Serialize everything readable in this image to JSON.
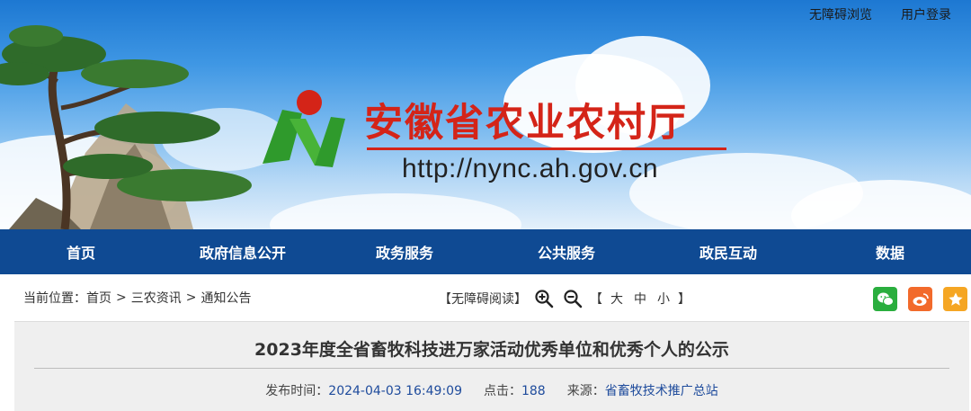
{
  "top_links": {
    "accessible": "无障碍浏览",
    "login": "用户登录"
  },
  "banner": {
    "site_title": "安徽省农业农村厅",
    "site_url": "http://nync.ah.gov.cn",
    "colors": {
      "title": "#d42418",
      "logo_green": "#2f9a2c",
      "logo_red": "#d42418"
    }
  },
  "nav": {
    "items": [
      "首页",
      "政府信息公开",
      "政务服务",
      "公共服务",
      "政民互动",
      "数据"
    ],
    "background": "#0f4a93"
  },
  "breadcrumb": {
    "prefix": "当前位置：",
    "items": [
      "首页",
      "三农资讯",
      "通知公告"
    ],
    "separator": ">"
  },
  "tools": {
    "accessible_read": "【无障碍阅读】",
    "zoom_in_icon": "zoom-in-icon",
    "zoom_out_icon": "zoom-out-icon",
    "font_open": "【",
    "font_large": "大",
    "font_medium": "中",
    "font_small": "小",
    "font_close": "】"
  },
  "share": {
    "icons": [
      "wechat-icon",
      "weibo-icon",
      "favorite-star-icon"
    ],
    "colors": [
      "#2aae3e",
      "#f26a2b",
      "#f5a623"
    ]
  },
  "article": {
    "title": "2023年度全省畜牧科技进万家活动优秀单位和优秀个人的公示",
    "publish_label": "发布时间：",
    "publish_time": "2024-04-03 16:49:09",
    "clicks_label": "点击：",
    "clicks": "188",
    "source_label": "来源：",
    "source": "省畜牧技术推广总站"
  }
}
